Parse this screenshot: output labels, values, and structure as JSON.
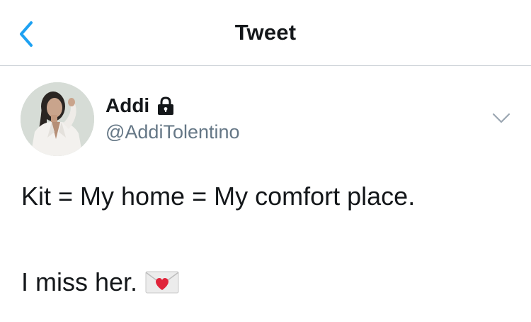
{
  "header": {
    "title": "Tweet",
    "back_icon": "chevron-left-icon",
    "accent_color": "#1da1f2"
  },
  "tweet": {
    "author": {
      "name": "Addi",
      "handle": "@AddiTolentino",
      "protected": true,
      "lock_icon": "lock-icon",
      "avatar_icon": "avatar-photo"
    },
    "menu_icon": "chevron-down-icon",
    "text_line_1": "Kit = My home = My comfort place.",
    "text_line_2": "I miss her.",
    "emoji": "love-letter-icon"
  },
  "colors": {
    "text": "#14171a",
    "handle": "#657786",
    "divider": "#cfd4d9",
    "background": "#ffffff"
  }
}
